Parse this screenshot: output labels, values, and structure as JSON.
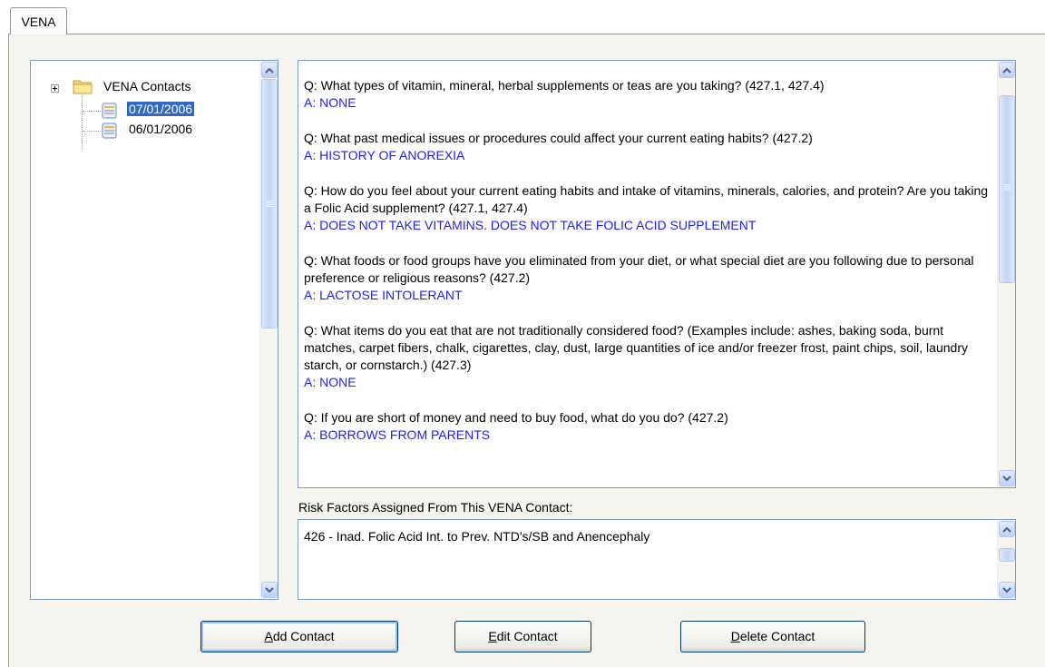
{
  "tab": {
    "label": "VENA"
  },
  "tree": {
    "root_label": "VENA Contacts",
    "items": [
      {
        "label": "07/01/2006",
        "selected": true
      },
      {
        "label": "06/01/2006",
        "selected": false
      }
    ]
  },
  "qa": [
    {
      "q": "Q: What types of vitamin, mineral, herbal supplements or teas are you taking? (427.1, 427.4)",
      "a": "A: NONE"
    },
    {
      "q": "Q: What past medical issues or procedures could affect your current eating habits? (427.2)",
      "a": "A: HISTORY OF ANOREXIA"
    },
    {
      "q": "Q: How do you feel about your current eating habits and intake of vitamins, minerals, calories, and protein?  Are you taking a Folic Acid supplement? (427.1, 427.4)",
      "a": "A: DOES NOT TAKE VITAMINS. DOES NOT TAKE FOLIC ACID SUPPLEMENT"
    },
    {
      "q": "Q: What foods or food groups have you eliminated from your diet, or what special diet are you following due to personal preference or religious reasons? (427.2)",
      "a": "A: LACTOSE INTOLERANT"
    },
    {
      "q": "Q: What items do you eat that are not traditionally considered food? (Examples include: ashes, baking soda, burnt matches, carpet fibers, chalk, cigarettes, clay, dust, large quantities of ice and/or freezer frost, paint chips, soil, laundry starch, or cornstarch.) (427.3)",
      "a": "A: NONE"
    },
    {
      "q": "Q: If you are short of money and need to buy food, what do you do? (427.2)",
      "a": "A: BORROWS FROM PARENTS"
    }
  ],
  "risk": {
    "label": "Risk Factors Assigned From This VENA Contact:",
    "items": [
      "426 - Inad. Folic Acid Int. to Prev. NTD's/SB and Anencephaly"
    ]
  },
  "buttons": {
    "add": {
      "pre": "",
      "key": "A",
      "post": "dd Contact"
    },
    "edit": {
      "pre": "",
      "key": "E",
      "post": "dit Contact"
    },
    "delete": {
      "pre": "",
      "key": "D",
      "post": "elete Contact"
    }
  },
  "colors": {
    "selection": "#316ac5",
    "answer_text": "#1f1ff0",
    "panel_bg": "#f5f4ee",
    "border": "#7f9db9"
  },
  "icons": {
    "tree_expander": "plus-box-icon",
    "tree_root": "folder-icon",
    "tree_item": "document-icon",
    "scroll_up": "chevron-up-icon",
    "scroll_down": "chevron-down-icon"
  }
}
